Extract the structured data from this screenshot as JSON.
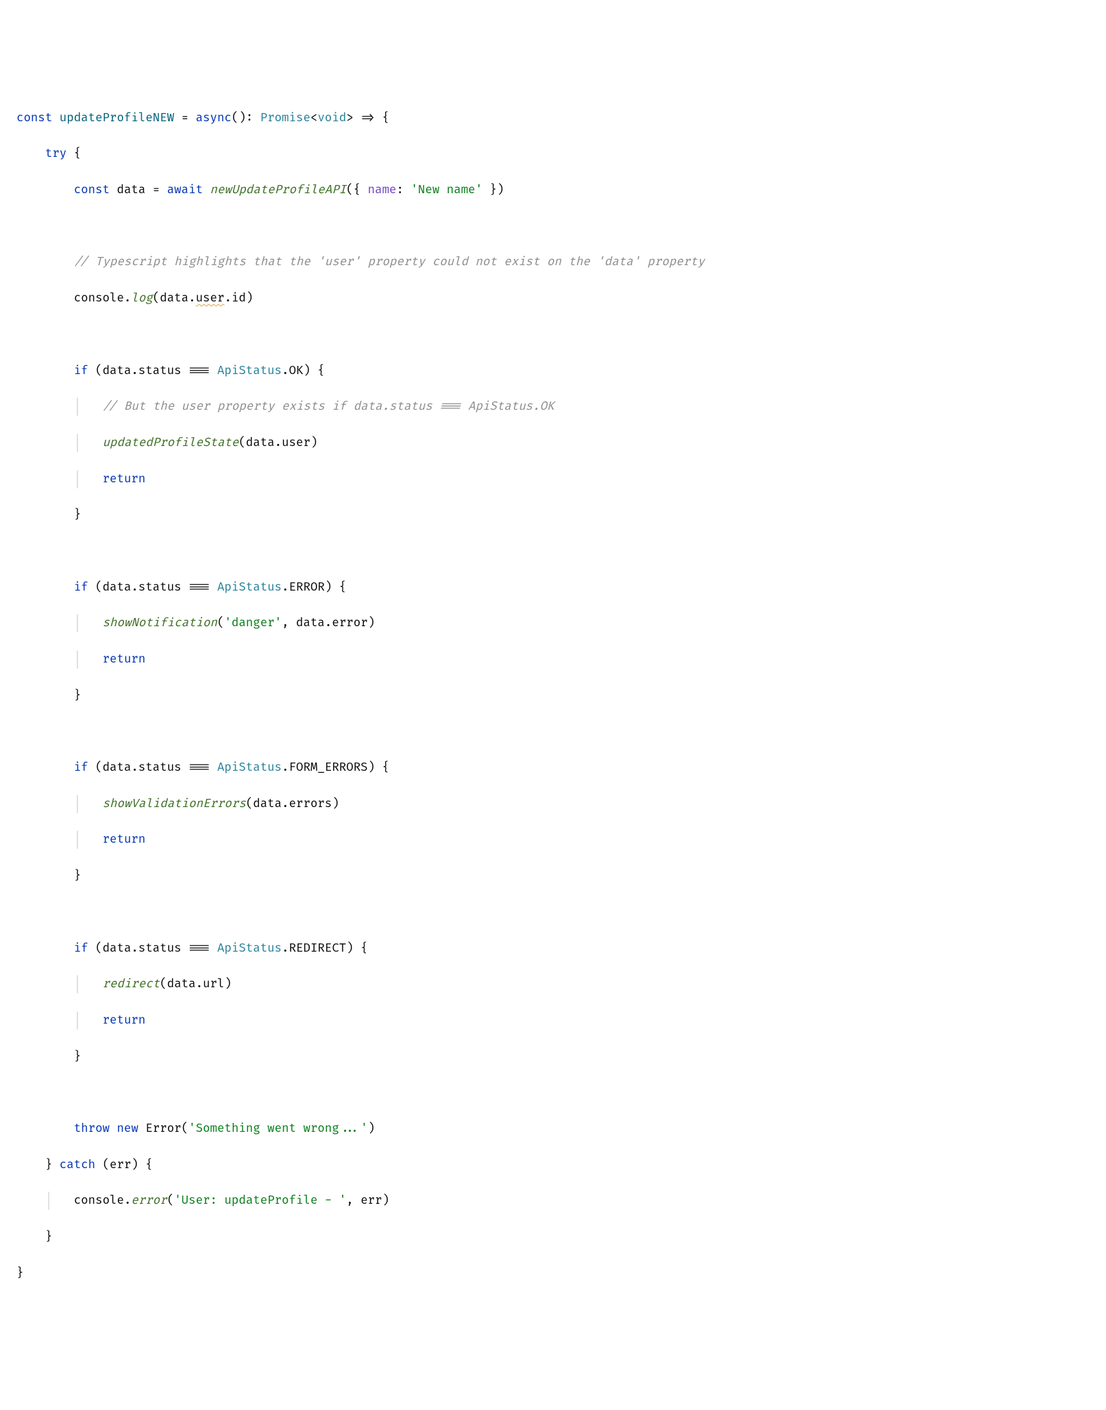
{
  "code": {
    "l1_const": "const",
    "l1_fn": "updateProfileNEW",
    "l1_eq": " = ",
    "l1_async": "async",
    "l1_paren": "():",
    "l1_promise": " Promise",
    "l1_void": "void",
    "l1_arrow": " => {",
    "l2_try": "try",
    "l2_brace": " {",
    "l3_const": "const",
    "l3_data": " data = ",
    "l3_await": "await",
    "l3_space": " ",
    "l3_call": "newUpdateProfileAPI",
    "l3_args_open": "({ ",
    "l3_name_key": "name",
    "l3_colon": ": ",
    "l3_name_val": "'New name'",
    "l3_args_close": " })",
    "l5_comment": "// Typescript highlights that the 'user' property could not exist on the 'data' property",
    "l6_console": "console.",
    "l6_log": "log",
    "l6_open": "(data.",
    "l6_user": "user",
    "l6_rest": ".id)",
    "l8_if": "if",
    "l8_cond_open": " (data.status === ",
    "l8_apistatus": "ApiStatus",
    "l8_ok": ".OK",
    "l8_cond_close": ") {",
    "l9_comment": "// But the user property exists if data.status === ApiStatus.OK",
    "l10_call": "updatedProfileState",
    "l10_args": "(data.user)",
    "l11_return": "return",
    "l12_close": "}",
    "l14_if": "if",
    "l14_cond_open": " (data.status === ",
    "l14_apistatus": "ApiStatus",
    "l14_err": ".ERROR",
    "l14_cond_close": ") {",
    "l15_call": "showNotification",
    "l15_open": "(",
    "l15_str": "'danger'",
    "l15_rest": ", data.error)",
    "l16_return": "return",
    "l17_close": "}",
    "l19_if": "if",
    "l19_cond_open": " (data.status === ",
    "l19_apistatus": "ApiStatus",
    "l19_fe": ".FORM_ERRORS",
    "l19_cond_close": ") {",
    "l20_call": "showValidationErrors",
    "l20_args": "(data.errors)",
    "l21_return": "return",
    "l22_close": "}",
    "l24_if": "if",
    "l24_cond_open": " (data.status === ",
    "l24_apistatus": "ApiStatus",
    "l24_re": ".REDIRECT",
    "l24_cond_close": ") {",
    "l25_call": "redirect",
    "l25_args": "(data.url)",
    "l26_return": "return",
    "l27_close": "}",
    "l29_throw": "throw new",
    "l29_err": " Error",
    "l29_open": "(",
    "l29_str": "'Something went wrong...'",
    "l29_close": ")",
    "l30_close": "} ",
    "l30_catch": "catch",
    "l30_err": " (err) {",
    "l31_console": "console.",
    "l31_error": "error",
    "l31_open": "(",
    "l31_str": "'User: updateProfile - '",
    "l31_rest": ", err)",
    "l32_close": "}",
    "l33_close": "}"
  }
}
